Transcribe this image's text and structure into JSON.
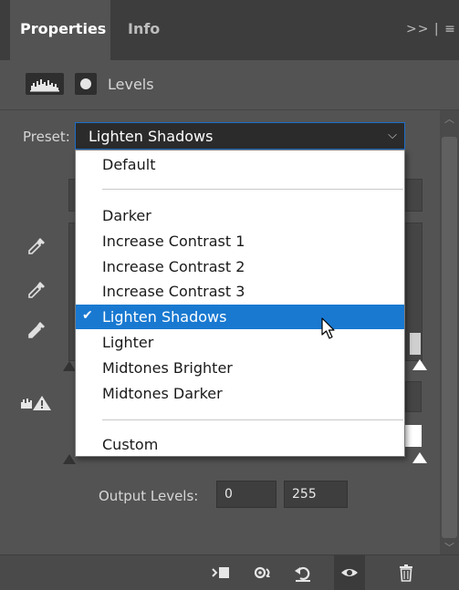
{
  "tabs": [
    {
      "label": "Properties",
      "active": true
    },
    {
      "label": "Info",
      "active": false
    }
  ],
  "tab_menu_glyph": ">> | ≡",
  "header": {
    "title": "Levels",
    "icons": [
      "histogram-icon",
      "layer-mask-icon"
    ]
  },
  "preset": {
    "label": "Preset:",
    "value": "Lighten Shadows",
    "options": [
      {
        "label": "Default",
        "group": 1
      },
      {
        "label": "Darker",
        "group": 2
      },
      {
        "label": "Increase Contrast 1",
        "group": 2
      },
      {
        "label": "Increase Contrast 2",
        "group": 2
      },
      {
        "label": "Increase Contrast 3",
        "group": 2
      },
      {
        "label": "Lighten Shadows",
        "group": 2,
        "selected": true
      },
      {
        "label": "Lighter",
        "group": 2
      },
      {
        "label": "Midtones Brighter",
        "group": 2
      },
      {
        "label": "Midtones Darker",
        "group": 2
      },
      {
        "label": "Custom",
        "group": 3
      }
    ]
  },
  "output_levels": {
    "label": "Output Levels:",
    "low": "0",
    "high": "255"
  },
  "footer_icons": [
    "clip-to-layer-icon",
    "view-previous-icon",
    "reset-icon",
    "visibility-eye-icon",
    "trash-icon"
  ],
  "colors": {
    "accent": "#1979d1",
    "panel": "#535353",
    "tabbar": "#3d3d3d"
  }
}
